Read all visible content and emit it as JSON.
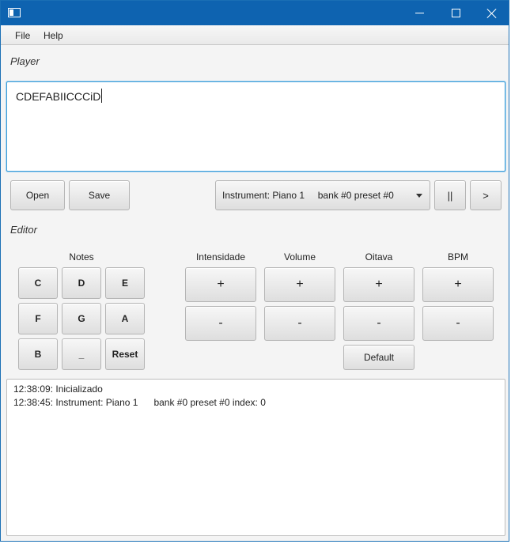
{
  "window": {
    "controls": {
      "minimize_icon": "minimize-icon",
      "maximize_icon": "maximize-icon",
      "close_icon": "close-icon"
    }
  },
  "menu": {
    "file": "File",
    "help": "Help"
  },
  "player": {
    "section_label": "Player",
    "text": "CDEFABIICCCiD",
    "open_label": "Open",
    "save_label": "Save",
    "instrument_value": "Instrument: Piano 1     bank #0 preset #0",
    "pause_label": "||",
    "play_label": ">"
  },
  "editor": {
    "section_label": "Editor",
    "notes_label": "Notes",
    "notes": [
      "C",
      "D",
      "E",
      "F",
      "G",
      "A",
      "B",
      "_",
      "Reset"
    ],
    "controls": [
      {
        "label": "Intensidade",
        "plus": "+",
        "minus": "-"
      },
      {
        "label": "Volume",
        "plus": "+",
        "minus": "-"
      },
      {
        "label": "Oitava",
        "plus": "+",
        "minus": "-"
      },
      {
        "label": "BPM",
        "plus": "+",
        "minus": "-"
      }
    ],
    "default_label": "Default"
  },
  "log": {
    "lines": [
      "12:38:09: Inicializado",
      "12:38:45: Instrument: Piano 1      bank #0 preset #0 index: 0"
    ]
  },
  "colors": {
    "titlebar": "#0e63b0",
    "focus_border": "#3d9ed8",
    "background": "#f4f4f4"
  }
}
